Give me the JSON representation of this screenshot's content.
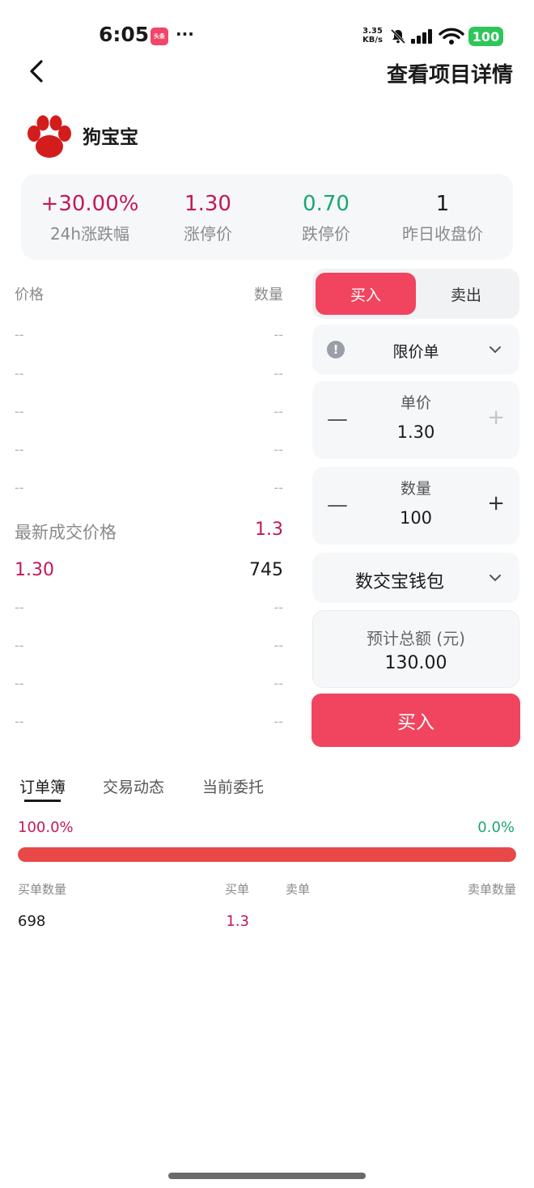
{
  "status": {
    "time": "6:05",
    "app_badge": "头条",
    "dots": "···",
    "net_speed_value": "3.35",
    "net_speed_unit": "KB/s",
    "battery": "100"
  },
  "header": {
    "title": "查看项目详情"
  },
  "token": {
    "name": "狗宝宝"
  },
  "stats": [
    {
      "value": "+30.00%",
      "label": "24h涨跌幅",
      "color": "#c2185b"
    },
    {
      "value": "1.30",
      "label": "涨停价",
      "color": "#c2185b"
    },
    {
      "value": "0.70",
      "label": "跌停价",
      "color": "#1ba870"
    },
    {
      "value": "1",
      "label": "昨日收盘价",
      "color": "#1a1a1a"
    }
  ],
  "orderbook": {
    "price_header": "价格",
    "qty_header": "数量",
    "asks": [
      {
        "price": "--",
        "qty": "--"
      },
      {
        "price": "--",
        "qty": "--"
      },
      {
        "price": "--",
        "qty": "--"
      },
      {
        "price": "--",
        "qty": "--"
      },
      {
        "price": "--",
        "qty": "--"
      }
    ],
    "latest_label": "最新成交价格",
    "latest_value": "1.3",
    "trade": {
      "price": "1.30",
      "qty": "745"
    },
    "bids": [
      {
        "price": "--",
        "qty": "--"
      },
      {
        "price": "--",
        "qty": "--"
      },
      {
        "price": "--",
        "qty": "--"
      },
      {
        "price": "--",
        "qty": "--"
      }
    ]
  },
  "trade_panel": {
    "buy_tab": "买入",
    "sell_tab": "卖出",
    "order_type": "限价单",
    "info_icon": "!",
    "unit_price_label": "单价",
    "unit_price_value": "1.30",
    "qty_label": "数量",
    "qty_value": "100",
    "minus": "—",
    "plus": "+",
    "wallet": "数交宝钱包",
    "total_label": "预计总额 (元)",
    "total_value": "130.00",
    "submit": "买入"
  },
  "tabs": [
    {
      "label": "订单簿",
      "active": true
    },
    {
      "label": "交易动态",
      "active": false
    },
    {
      "label": "当前委托",
      "active": false
    }
  ],
  "ratio": {
    "buy_pct": "100.0%",
    "sell_pct": "0.0%",
    "buy_fraction": 1.0
  },
  "depth": {
    "headers": {
      "buy_qty": "买单数量",
      "buy": "买单",
      "sell": "卖单",
      "sell_qty": "卖单数量"
    },
    "rows": [
      {
        "buy_qty": "698",
        "buy": "1.3"
      }
    ]
  },
  "colors": {
    "accent": "#f0445f",
    "up": "#c2185b",
    "down": "#1ba870",
    "bar": "#e84848"
  }
}
